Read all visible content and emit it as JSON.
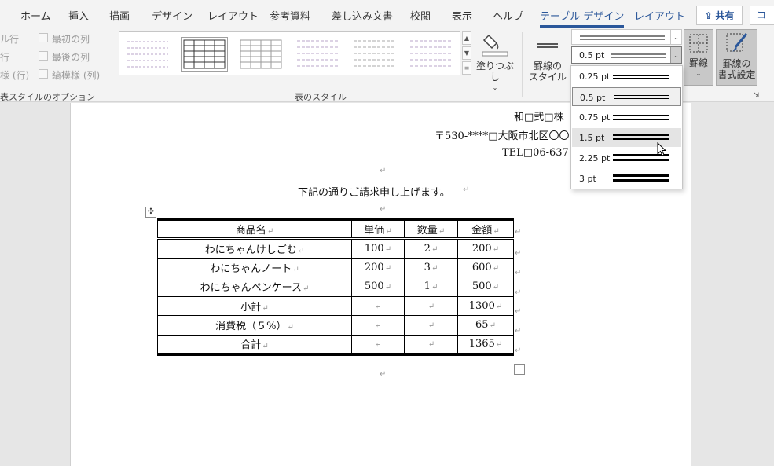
{
  "tabs": [
    {
      "label": "ホーム"
    },
    {
      "label": "挿入"
    },
    {
      "label": "描画"
    },
    {
      "label": "デザイン"
    },
    {
      "label": "レイアウト"
    },
    {
      "label": "参考資料"
    },
    {
      "label": "差し込み文書"
    },
    {
      "label": "校閲"
    },
    {
      "label": "表示"
    },
    {
      "label": "ヘルプ"
    },
    {
      "label": "テーブル デザイン"
    },
    {
      "label": "レイアウト"
    }
  ],
  "share_label": "共有",
  "comment_label": "コ",
  "table_style_options": {
    "left_items": [
      "ル行",
      "行",
      "様 (行)"
    ],
    "right_items": [
      "最初の列",
      "最後の列",
      "縞模様 (列)"
    ],
    "group_label": "表スタイルのオプション"
  },
  "table_styles": {
    "group_label": "表のスタイル"
  },
  "shading_label": "塗りつぶし",
  "border_styles_label": [
    "罫線の",
    "スタイル"
  ],
  "border_weight_value": "0.5 pt",
  "borders_label": "罫線",
  "border_painter_label": [
    "罫線の",
    "書式設定"
  ],
  "weight_menu": [
    {
      "label": "0.25 pt",
      "pt": 0.25,
      "state": "normal"
    },
    {
      "label": "0.5 pt",
      "pt": 0.5,
      "state": "selected"
    },
    {
      "label": "0.75 pt",
      "pt": 0.75,
      "state": "normal"
    },
    {
      "label": "1.5 pt",
      "pt": 1.5,
      "state": "hover"
    },
    {
      "label": "2.25 pt",
      "pt": 2.25,
      "state": "normal"
    },
    {
      "label": "3 pt",
      "pt": 3,
      "state": "normal"
    }
  ],
  "document": {
    "company": "和□弐□株",
    "address": "〒530-****□大阪市北区〇〇",
    "tel": "TEL□06-637",
    "intro": "下記の通りご請求申し上げます。",
    "return_mark": "↵",
    "table": {
      "headers": [
        "商品名",
        "単価",
        "数量",
        "金額"
      ],
      "rows": [
        [
          "わにちゃんけしごむ",
          "100",
          "2",
          "200"
        ],
        [
          "わにちゃんノート",
          "200",
          "3",
          "600"
        ],
        [
          "わにちゃんペンケース",
          "500",
          "1",
          "500"
        ],
        [
          "小計",
          "",
          "",
          "1300"
        ],
        [
          "消費税（５%）",
          "",
          "",
          "65"
        ],
        [
          "合計",
          "",
          "",
          "1365"
        ]
      ]
    }
  },
  "colors": {
    "accent": "#2b579a",
    "ribbon_bg": "#f3f3f3",
    "canvas": "#e6e6e6"
  }
}
